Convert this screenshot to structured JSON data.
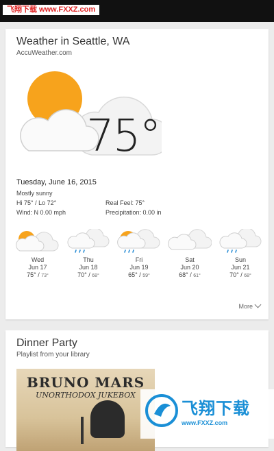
{
  "watermark": {
    "top_text": "飞翔下载 www.FXXZ.com",
    "bottom_text": "飞翔下载",
    "bottom_url": "www.FXXZ.com"
  },
  "weather": {
    "title": "Weather in Seattle, WA",
    "source": "AccuWeather.com",
    "current_temp": "75°",
    "current_icon": "partly-sunny-icon",
    "date": "Tuesday, June 16, 2015",
    "condition": "Mostly sunny",
    "hi_lo": "Hi 75° / Lo 72°",
    "real_feel": "Real Feel: 75°",
    "wind": "Wind: N 0.00 mph",
    "precipitation": "Precipitation: 0.00 in",
    "more_label": "More",
    "forecast": [
      {
        "day": "Wed",
        "date": "Jun 17",
        "hi": "75°",
        "lo": "73°",
        "icon": "partly-sunny-icon"
      },
      {
        "day": "Thu",
        "date": "Jun 18",
        "hi": "70°",
        "lo": "68°",
        "icon": "rain-cloud-icon"
      },
      {
        "day": "Fri",
        "date": "Jun 19",
        "hi": "65°",
        "lo": "59°",
        "icon": "sun-rain-icon"
      },
      {
        "day": "Sat",
        "date": "Jun 20",
        "hi": "68°",
        "lo": "61°",
        "icon": "cloudy-icon"
      },
      {
        "day": "Sun",
        "date": "Jun 21",
        "hi": "70°",
        "lo": "68°",
        "icon": "rain-cloud-icon"
      }
    ]
  },
  "playlist": {
    "title": "Dinner Party",
    "subtitle": "Playlist from your library",
    "album_artist": "BRUNO MARS",
    "album_title": "UNORTHODOX JUKEBOX"
  }
}
